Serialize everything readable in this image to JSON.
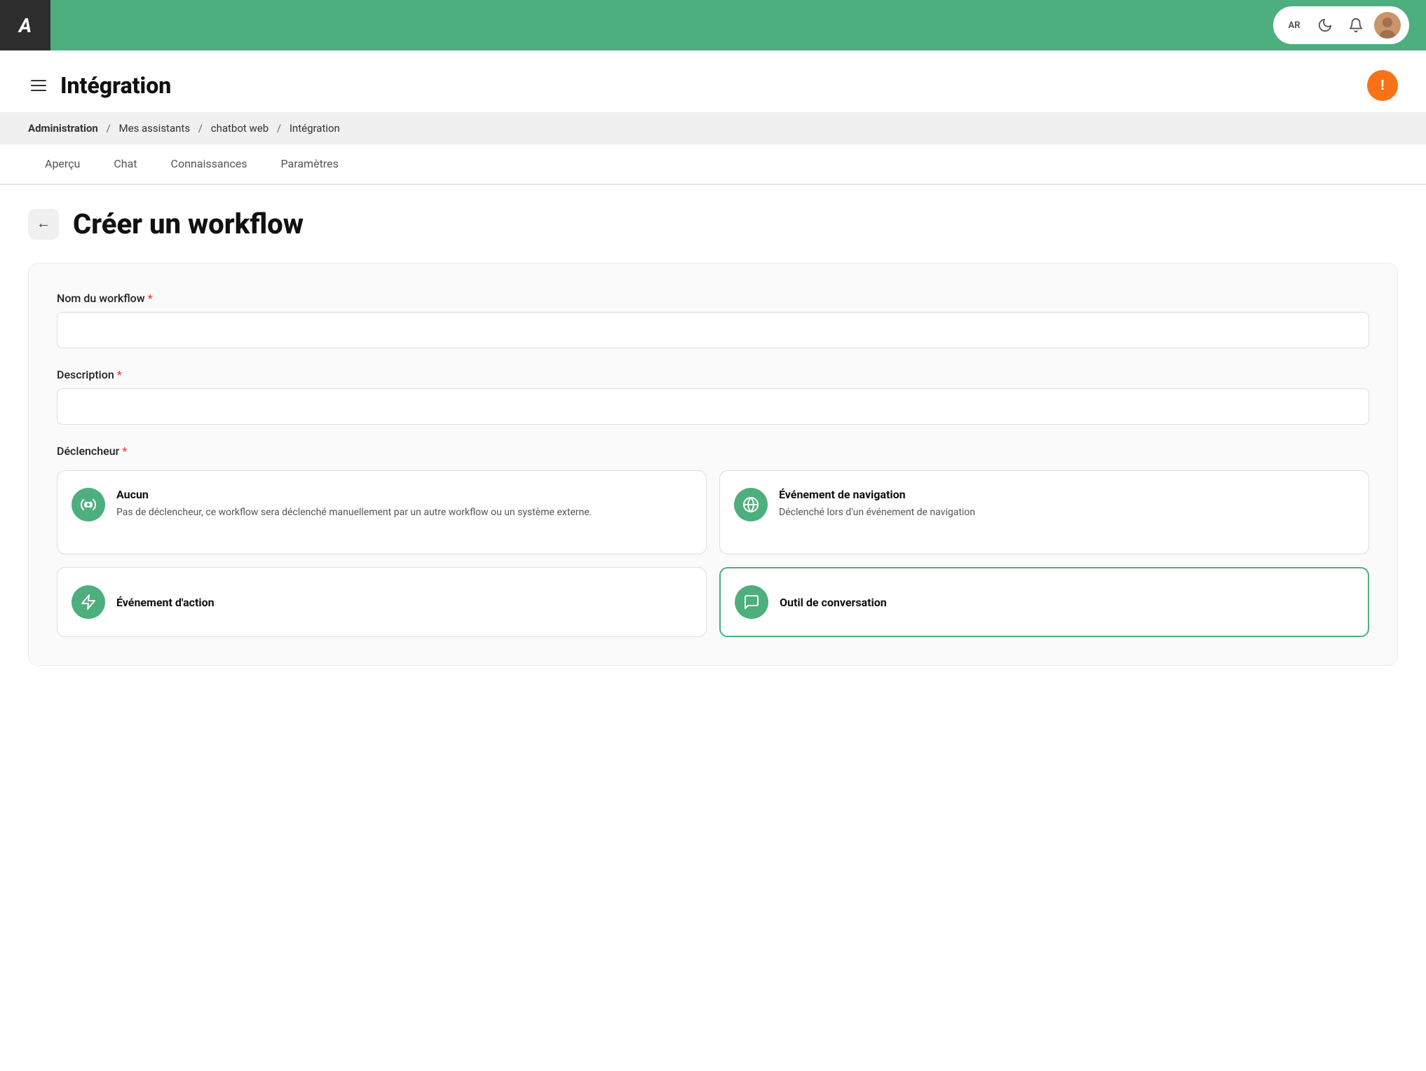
{
  "topbar": {
    "logo": "A",
    "icons": {
      "translate": "AR",
      "dark_mode": "🌙",
      "bell": "🔔"
    }
  },
  "page": {
    "hamburger_label": "menu",
    "title": "Intégration",
    "alert_icon": "!"
  },
  "breadcrumb": {
    "items": [
      {
        "label": "Administration",
        "bold": true
      },
      {
        "label": "Mes assistants"
      },
      {
        "label": "chatbot web"
      },
      {
        "label": "Intégration"
      }
    ],
    "separator": "/"
  },
  "tabs": [
    {
      "label": "Aperçu",
      "active": false
    },
    {
      "label": "Chat",
      "active": false
    },
    {
      "label": "Connaissances",
      "active": false
    },
    {
      "label": "Paramètres",
      "active": false
    }
  ],
  "workflow": {
    "back_label": "←",
    "title": "Créer un workflow",
    "form": {
      "name_label": "Nom du workflow",
      "name_required": "*",
      "name_placeholder": "",
      "desc_label": "Description",
      "desc_required": "*",
      "desc_placeholder": "",
      "trigger_label": "Déclencheur",
      "trigger_required": "*"
    },
    "triggers": [
      {
        "id": "aucun",
        "name": "Aucun",
        "desc": "Pas de déclencheur, ce workflow sera déclenché manuellement par un autre workflow ou un système externe.",
        "icon": "⚙",
        "selected": false
      },
      {
        "id": "navigation",
        "name": "Événement de navigation",
        "desc": "Déclenché lors d'un événement de navigation",
        "icon": "🌐",
        "selected": false
      }
    ],
    "triggers_bottom": [
      {
        "id": "action",
        "name": "Événement d'action",
        "icon": "⚡",
        "selected": false
      },
      {
        "id": "conversation",
        "name": "Outil de conversation",
        "icon": "💬",
        "selected": true
      }
    ]
  }
}
